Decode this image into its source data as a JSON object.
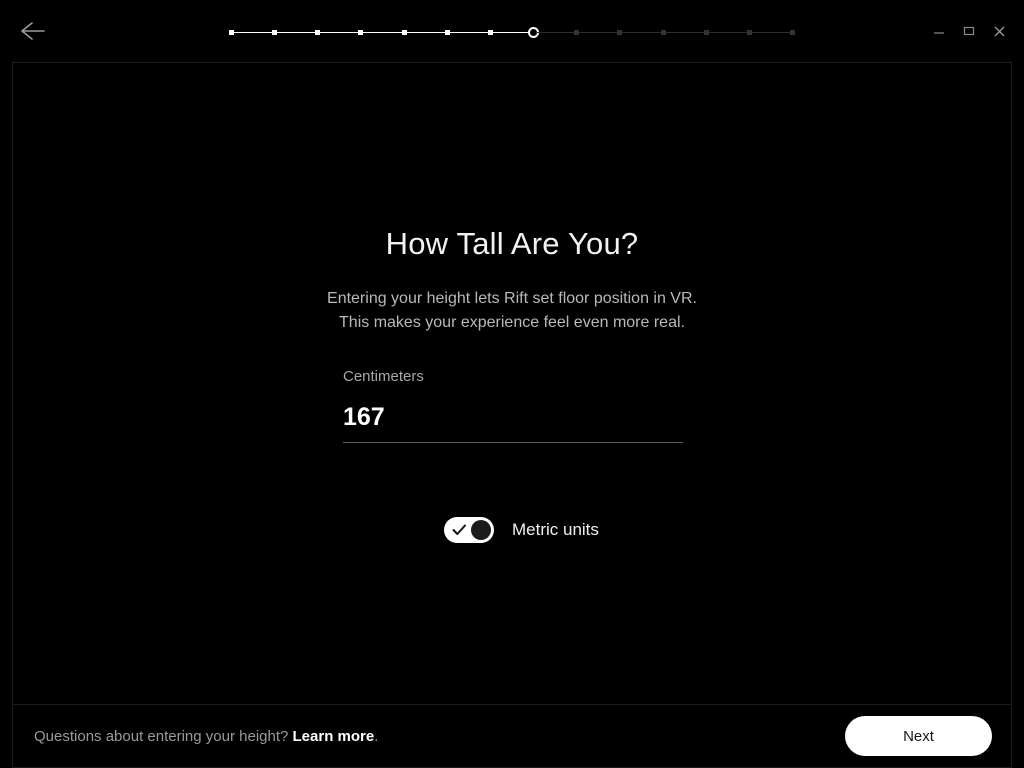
{
  "window": {
    "back_icon": "arrow-left-icon",
    "minimize_label": "—",
    "maximize_label": "□",
    "close_label": "×"
  },
  "progress": {
    "total_steps": 14,
    "current_step": 8,
    "completed_steps": 7,
    "remaining_steps": 6
  },
  "main": {
    "headline": "How Tall Are You?",
    "subtitle_line1": "Entering your height lets Rift set floor position in VR.",
    "subtitle_line2": "This makes your experience feel even more real.",
    "field": {
      "label": "Centimeters",
      "value": "167",
      "placeholder": "167"
    },
    "toggle": {
      "label": "Metric units",
      "checked": true,
      "check_icon": "checkmark-icon"
    }
  },
  "footer": {
    "question_text": "Questions about entering your height?",
    "link_text": "Learn more",
    "period": ".",
    "next_label": "Next"
  },
  "colors": {
    "background": "#000000",
    "panel_border": "#1c1c1c",
    "headline": "#f2f2f2",
    "subtitle": "#b9b9b9",
    "label": "#a8a8a8",
    "value": "#ffffff",
    "underline": "#5c5c5c",
    "accent_white": "#ffffff",
    "step_done": "#ffffff",
    "step_todo": "#333333",
    "button_text": "#161616"
  }
}
